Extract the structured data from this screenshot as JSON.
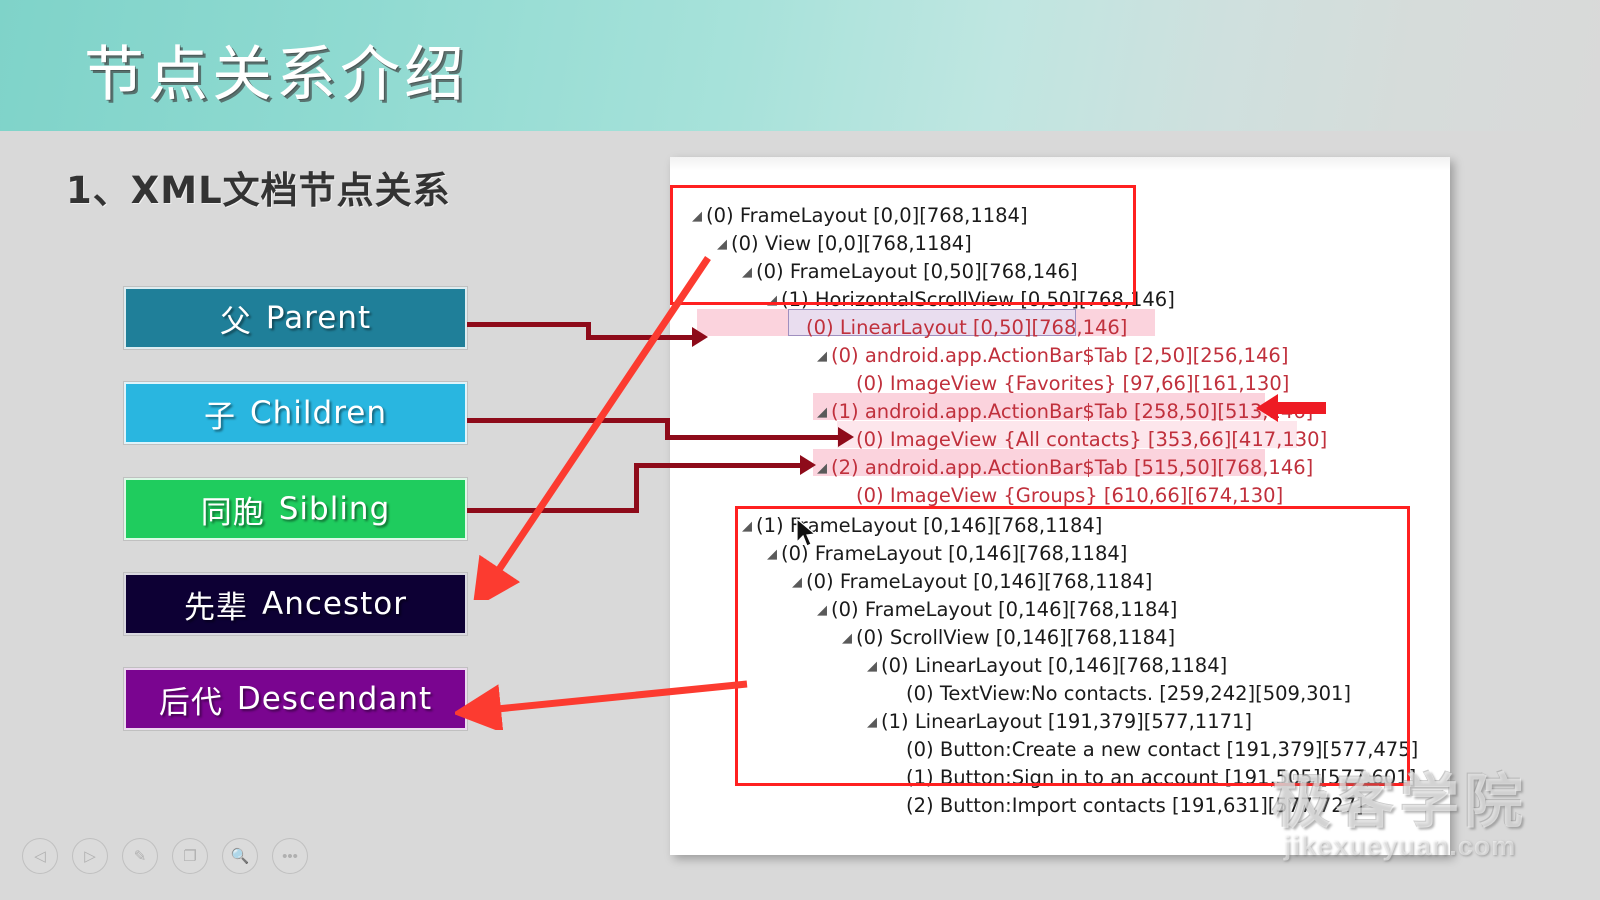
{
  "slide": {
    "title": "节点关系介绍",
    "heading": "1、XML文档节点关系",
    "background_color": "#d9d9d9",
    "banner_color_left": "#7fd3c9"
  },
  "relations": [
    {
      "cn": "父",
      "en": "Parent",
      "color": "#1f7f99"
    },
    {
      "cn": "子",
      "en": "Children",
      "color": "#29b6e0"
    },
    {
      "cn": "同胞",
      "en": "Sibling",
      "color": "#1fcc5e"
    },
    {
      "cn": "先辈",
      "en": "Ancestor",
      "color": "#0d0034"
    },
    {
      "cn": "后代",
      "en": "Descendant",
      "color": "#7a0590"
    }
  ],
  "tree": {
    "rows": [
      {
        "text": "(0) FrameLayout [0,0][768,1184]",
        "twig": "◢",
        "indent": 0
      },
      {
        "text": "(0) View [0,0][768,1184]",
        "twig": "◢",
        "indent": 1
      },
      {
        "text": "(0) FrameLayout [0,50][768,146]",
        "twig": "◢",
        "indent": 2
      },
      {
        "text": "(1) HorizontalScrollView [0,50][768,146]",
        "twig": "◢",
        "indent": 3
      },
      {
        "text": "(0) LinearLayout [0,50][768,146]",
        "twig": "◢",
        "indent": 4
      },
      {
        "text": "(0) android.app.ActionBar$Tab [2,50][256,146]",
        "twig": "◢",
        "indent": 5
      },
      {
        "text": "(0) ImageView {Favorites} [97,66][161,130]",
        "twig": "",
        "indent": 6
      },
      {
        "text": "(1) android.app.ActionBar$Tab [258,50][513,146]",
        "twig": "◢",
        "indent": 5
      },
      {
        "text": "(0) ImageView {All contacts} [353,66][417,130]",
        "twig": "",
        "indent": 6
      },
      {
        "text": "(2) android.app.ActionBar$Tab [515,50][768,146]",
        "twig": "◢",
        "indent": 5
      },
      {
        "text": "(0) ImageView {Groups} [610,66][674,130]",
        "twig": "",
        "indent": 6
      },
      {
        "text": "(1) FrameLayout [0,146][768,1184]",
        "twig": "◢",
        "indent": 2
      },
      {
        "text": "(0) FrameLayout [0,146][768,1184]",
        "twig": "◢",
        "indent": 3
      },
      {
        "text": "(0) FrameLayout [0,146][768,1184]",
        "twig": "◢",
        "indent": 4
      },
      {
        "text": "(0) FrameLayout [0,146][768,1184]",
        "twig": "◢",
        "indent": 5
      },
      {
        "text": "(0) ScrollView [0,146][768,1184]",
        "twig": "◢",
        "indent": 6
      },
      {
        "text": "(0) LinearLayout [0,146][768,1184]",
        "twig": "◢",
        "indent": 7
      },
      {
        "text": "(0) TextView:No contacts. [259,242][509,301]",
        "twig": "",
        "indent": 8
      },
      {
        "text": "(1) LinearLayout [191,379][577,1171]",
        "twig": "◢",
        "indent": 7
      },
      {
        "text": "(0) Button:Create a new contact [191,379][577,475]",
        "twig": "",
        "indent": 8
      },
      {
        "text": "(1) Button:Sign in to an account [191,505][577,601]",
        "twig": "",
        "indent": 8
      },
      {
        "text": "(2) Button:Import contacts [191,631][577,727]",
        "twig": "",
        "indent": 8
      }
    ],
    "highlight_color": "#fbd3dd",
    "selection_border_color": "#9f8fbf",
    "annotation_rect_color": "#ff2020"
  },
  "toolbar": {
    "buttons": [
      {
        "name": "previous",
        "glyph": "◁"
      },
      {
        "name": "play",
        "glyph": "▷"
      },
      {
        "name": "pen",
        "glyph": "✎"
      },
      {
        "name": "screen",
        "glyph": "❐"
      },
      {
        "name": "zoom",
        "glyph": "🔍"
      },
      {
        "name": "more",
        "glyph": "•••"
      }
    ]
  },
  "watermark": {
    "cn": "极客学院",
    "en": "jikexueyuan.com"
  }
}
